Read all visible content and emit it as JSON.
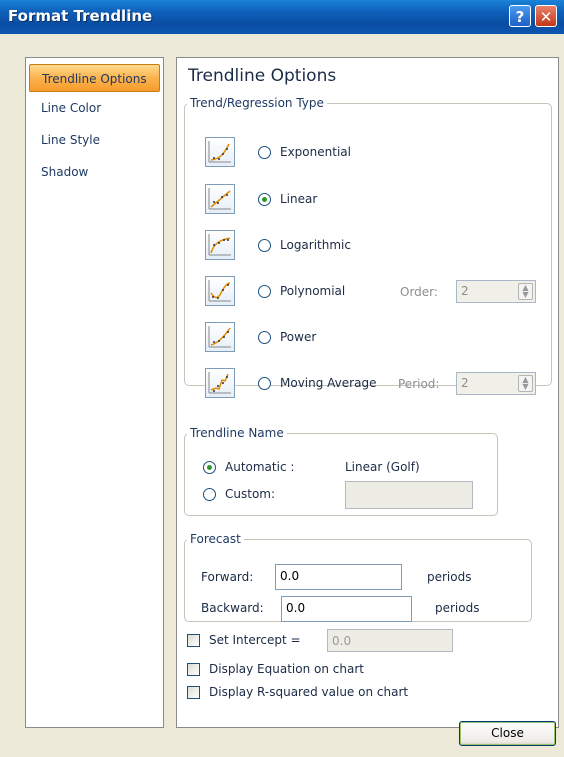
{
  "window": {
    "title": "Format Trendline",
    "help_label": "?",
    "close_label": "✕"
  },
  "sidebar": {
    "items": [
      {
        "label": "Trendline Options",
        "selected": true
      },
      {
        "label": "Line Color",
        "selected": false
      },
      {
        "label": "Line Style",
        "selected": false
      },
      {
        "label": "Shadow",
        "selected": false
      }
    ]
  },
  "panel": {
    "title": "Trendline Options",
    "regression": {
      "group_label": "Trend/Regression Type",
      "selected": "Linear",
      "types": [
        {
          "label": "Exponential",
          "icon": "exponential-chart-icon"
        },
        {
          "label": "Linear",
          "icon": "linear-chart-icon"
        },
        {
          "label": "Logarithmic",
          "icon": "logarithmic-chart-icon"
        },
        {
          "label": "Polynomial",
          "icon": "polynomial-chart-icon"
        },
        {
          "label": "Power",
          "icon": "power-chart-icon"
        },
        {
          "label": "Moving Average",
          "icon": "moving-average-chart-icon"
        }
      ],
      "order_label": "Order:",
      "order_value": "2",
      "period_label": "Period:",
      "period_value": "2"
    },
    "name": {
      "group_label": "Trendline Name",
      "automatic_label": "Automatic :",
      "automatic_value": "Linear (Golf)",
      "custom_label": "Custom:",
      "custom_value": "",
      "selected": "Automatic"
    },
    "forecast": {
      "group_label": "Forecast",
      "forward_label": "Forward:",
      "forward_value": "0.0",
      "forward_unit": "periods",
      "backward_label": "Backward:",
      "backward_value": "0.0",
      "backward_unit": "periods"
    },
    "options": {
      "set_intercept_label": "Set Intercept =",
      "set_intercept_value": "0.0",
      "display_equation_label": "Display Equation on chart",
      "display_rsquared_label": "Display R-squared value on chart"
    }
  },
  "footer": {
    "close_label": "Close"
  },
  "colors": {
    "titlebar": "#0a4ea3",
    "selected_nav": "#f59c2c",
    "radio_dot": "#2a9a2a"
  }
}
